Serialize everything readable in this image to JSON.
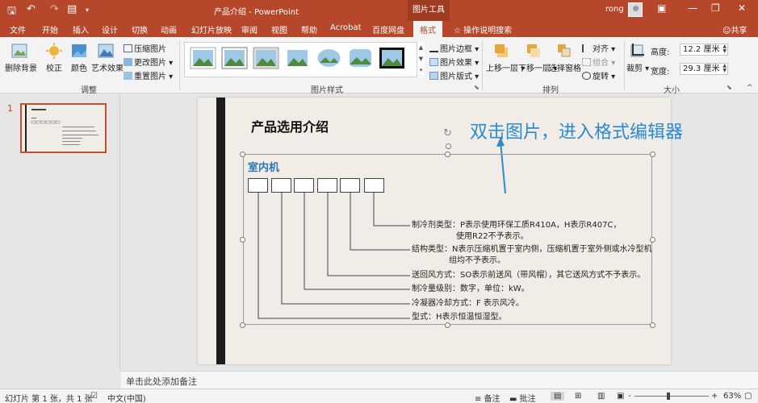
{
  "titlebar": {
    "title": "产品介绍 - PowerPoint",
    "context_tab": "图片工具",
    "user": "rong"
  },
  "tabs": [
    {
      "label": "文件"
    },
    {
      "label": "开始"
    },
    {
      "label": "插入"
    },
    {
      "label": "设计"
    },
    {
      "label": "切换"
    },
    {
      "label": "动画"
    },
    {
      "label": "幻灯片放映"
    },
    {
      "label": "审阅"
    },
    {
      "label": "视图"
    },
    {
      "label": "帮助"
    },
    {
      "label": "Acrobat"
    },
    {
      "label": "百度网盘"
    },
    {
      "label": "格式"
    }
  ],
  "tellme": "操作说明搜索",
  "share": "共享",
  "ribbon": {
    "remove_bg": "删除背景",
    "correct": "校正",
    "color": "颜色",
    "art_effects": "艺术效果",
    "compress": "压缩图片",
    "change": "更改图片",
    "reset": "重置图片",
    "group_adjust": "调整",
    "group_styles": "图片样式",
    "border": "图片边框",
    "effects": "图片效果",
    "layout": "图片版式",
    "bring_forward": "上移一层",
    "send_backward": "下移一层",
    "selection_pane": "选择窗格",
    "align": "对齐",
    "group": "组合",
    "rotate": "旋转",
    "group_arrange": "排列",
    "crop": "裁剪",
    "height_label": "高度:",
    "height_value": "12.2 厘米",
    "width_label": "宽度:",
    "width_value": "29.3 厘米",
    "group_size": "大小"
  },
  "slides_pane": {
    "slide_number": "1"
  },
  "slide": {
    "title": "产品选用介绍",
    "annotation": "双击图片，进入格式编辑器",
    "picture_heading": "室内机",
    "descriptions": [
      "制冷剂类型：P表示使用环保工质R410A，H表示R407C，",
      "使用R22不予表示。",
      "结构类型：N表示压缩机置于室内侧，压缩机置于室外侧或水冷型机",
      "组均不予表示。",
      "送回风方式：SO表示前送风（带风帽），其它送风方式不予表示。",
      "制冷量级别：数字，单位：kW。",
      "冷凝器冷却方式：F 表示风冷。",
      "型式：H表示恒温恒湿型。"
    ]
  },
  "notes_placeholder": "单击此处添加备注",
  "statusbar": {
    "slide_info": "幻灯片 第 1 张，共 1 张",
    "language": "中文(中国)",
    "notes": "备注",
    "comments": "批注",
    "zoom": "63%",
    "zoom_level": 0.63
  },
  "colors": {
    "accent": "#b7472a",
    "annotation": "#2b8bd1",
    "heading": "#2b75b9"
  }
}
